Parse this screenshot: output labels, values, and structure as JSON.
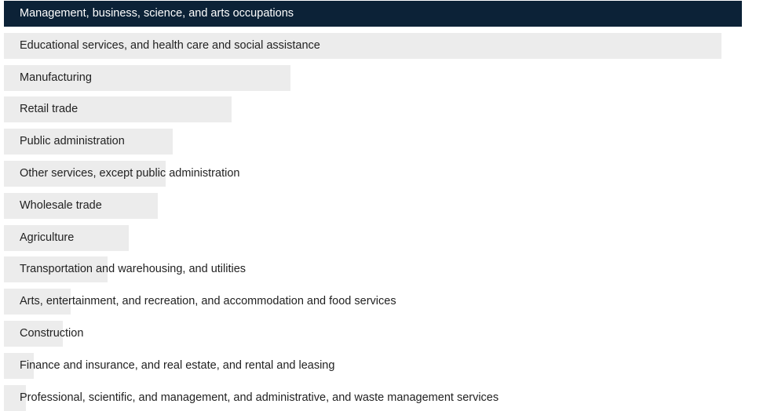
{
  "chart_data": {
    "type": "bar",
    "orientation": "horizontal",
    "categories": [
      "Management, business, science, and arts occupations",
      "Educational services, and health care and social assistance",
      "Manufacturing",
      "Retail trade",
      "Public administration",
      "Other services, except public administration",
      "Wholesale trade",
      "Agriculture",
      "Transportation and warehousing, and utilities",
      "Arts, entertainment, and recreation, and accommodation and food services",
      "Construction",
      "Finance and insurance, and real estate, and rental and leasing",
      "Professional, scientific, and management, and administrative, and waste management services"
    ],
    "values": [
      100,
      97.2,
      38.8,
      30.8,
      22.9,
      21.9,
      20.9,
      16.9,
      14.0,
      9.0,
      8.0,
      4.0,
      3.0
    ],
    "highlight_index": 0,
    "colors": {
      "highlight_bar": "#0c2237",
      "bar": "#ececec",
      "highlight_text": "#ffffff",
      "text": "#222222"
    },
    "xlim": [
      0,
      100
    ],
    "grid": false,
    "legend": "none"
  }
}
